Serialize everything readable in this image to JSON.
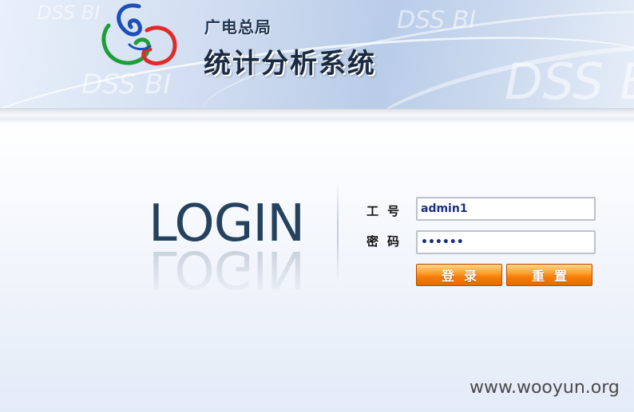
{
  "banner": {
    "watermark_text": "DSS BI",
    "subtitle": "广电总局",
    "title": "统计分析系统"
  },
  "login_panel": {
    "big_label": "LOGIN",
    "user_field": {
      "label": "工号",
      "value": "admin1"
    },
    "password_field": {
      "label": "密码",
      "value": "••••••"
    },
    "login_button": "登录",
    "reset_button": "重置"
  },
  "footer": {
    "site_watermark": "www.wooyun.org"
  },
  "colors": {
    "title_dark": "#1a2a40",
    "login_word": "#24425e",
    "button_orange": "#f57e0b",
    "input_text": "#1a2f80"
  },
  "icons": {
    "logo": "swirl-logo-icon"
  }
}
